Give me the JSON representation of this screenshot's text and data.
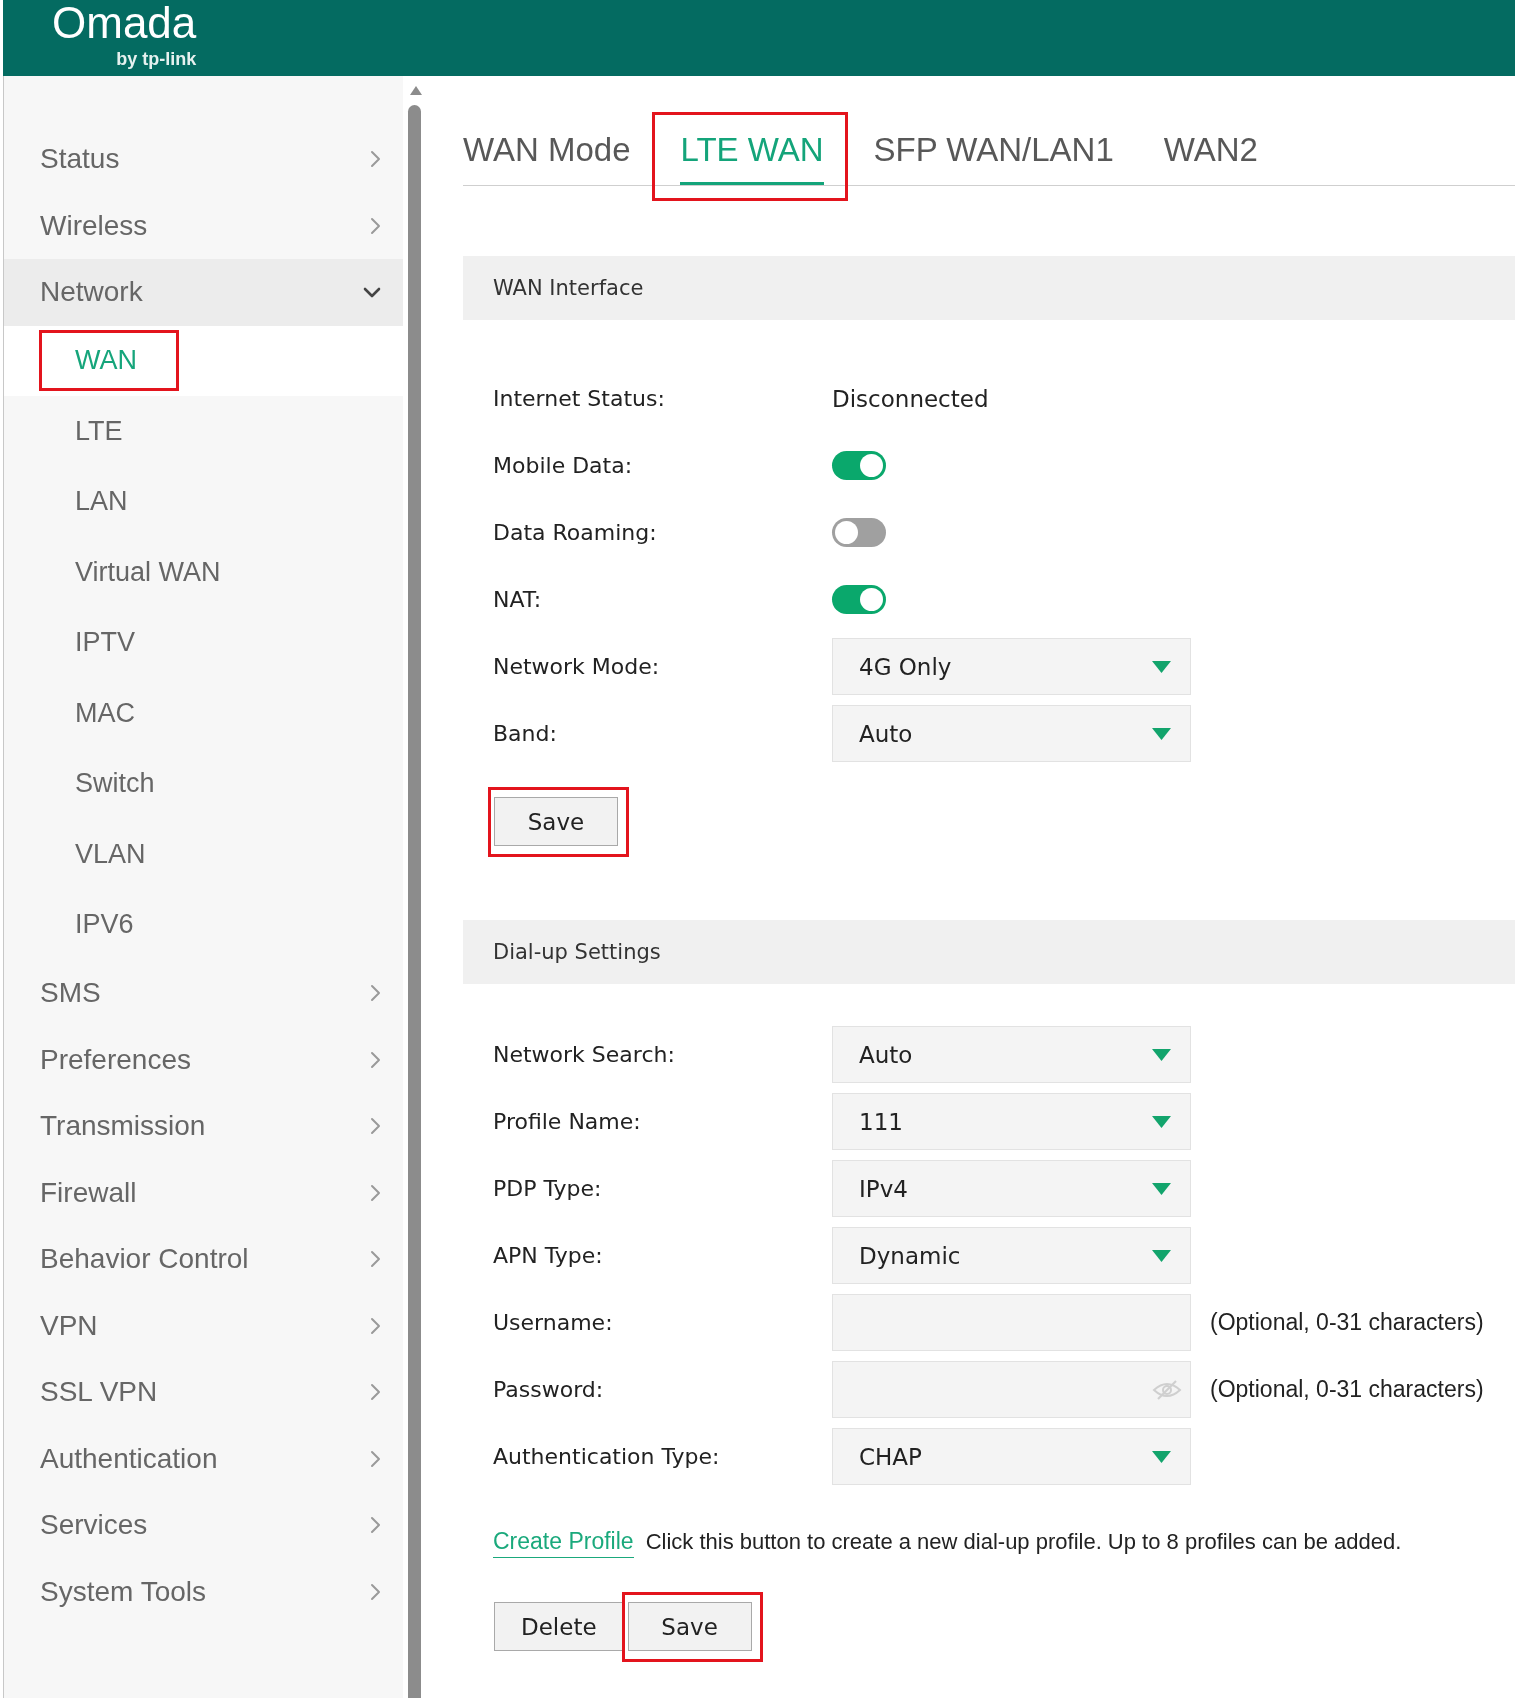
{
  "header": {
    "logo": "Omada",
    "logo_tagline": "by tp-link"
  },
  "sidebar": {
    "items": [
      {
        "label": "Status",
        "expanded": false
      },
      {
        "label": "Wireless",
        "expanded": false
      },
      {
        "label": "Network",
        "expanded": true,
        "children": [
          {
            "label": "WAN",
            "selected": true,
            "highlighted": true
          },
          {
            "label": "LTE",
            "selected": false,
            "highlighted": false
          },
          {
            "label": "LAN",
            "selected": false,
            "highlighted": false
          },
          {
            "label": "Virtual WAN",
            "selected": false,
            "highlighted": false
          },
          {
            "label": "IPTV",
            "selected": false,
            "highlighted": false
          },
          {
            "label": "MAC",
            "selected": false,
            "highlighted": false
          },
          {
            "label": "Switch",
            "selected": false,
            "highlighted": false
          },
          {
            "label": "VLAN",
            "selected": false,
            "highlighted": false
          },
          {
            "label": "IPV6",
            "selected": false,
            "highlighted": false
          }
        ]
      },
      {
        "label": "SMS",
        "expanded": false
      },
      {
        "label": "Preferences",
        "expanded": false
      },
      {
        "label": "Transmission",
        "expanded": false
      },
      {
        "label": "Firewall",
        "expanded": false
      },
      {
        "label": "Behavior Control",
        "expanded": false
      },
      {
        "label": "VPN",
        "expanded": false
      },
      {
        "label": "SSL VPN",
        "expanded": false
      },
      {
        "label": "Authentication",
        "expanded": false
      },
      {
        "label": "Services",
        "expanded": false
      },
      {
        "label": "System Tools",
        "expanded": false
      }
    ]
  },
  "tabs": [
    {
      "label": "WAN Mode",
      "selected": false,
      "highlighted": false
    },
    {
      "label": "LTE WAN",
      "selected": true,
      "highlighted": true
    },
    {
      "label": "SFP WAN/LAN1",
      "selected": false,
      "highlighted": false
    },
    {
      "label": "WAN2",
      "selected": false,
      "highlighted": false
    }
  ],
  "sections": [
    {
      "title": "WAN Interface",
      "fields": [
        {
          "kind": "text",
          "label": "Internet Status:",
          "value": "Disconnected"
        },
        {
          "kind": "toggle",
          "label": "Mobile Data:",
          "on": true
        },
        {
          "kind": "toggle",
          "label": "Data Roaming:",
          "on": false
        },
        {
          "kind": "toggle",
          "label": "NAT:",
          "on": true
        },
        {
          "kind": "select",
          "label": "Network Mode:",
          "value": "4G Only"
        },
        {
          "kind": "select",
          "label": "Band:",
          "value": "Auto"
        }
      ],
      "buttons": [
        {
          "label": "Save",
          "highlighted": true
        }
      ]
    },
    {
      "title": "Dial-up Settings",
      "fields": [
        {
          "kind": "select",
          "label": "Network Search:",
          "value": "Auto"
        },
        {
          "kind": "select",
          "label": "Profile Name:",
          "value": "111"
        },
        {
          "kind": "select",
          "label": "PDP Type:",
          "value": "IPv4"
        },
        {
          "kind": "select",
          "label": "APN Type:",
          "value": "Dynamic"
        },
        {
          "kind": "input",
          "label": "Username:",
          "note": "(Optional, 0-31 characters)"
        },
        {
          "kind": "password",
          "label": "Password:",
          "note": "(Optional, 0-31 characters)"
        },
        {
          "kind": "select",
          "label": "Authentication Type:",
          "value": "CHAP"
        }
      ],
      "link": {
        "label": "Create Profile",
        "description": "Click this button to create a new dial-up profile. Up to 8 profiles can be added."
      },
      "buttons": [
        {
          "label": "Delete",
          "highlighted": false
        },
        {
          "label": "Save",
          "highlighted": true
        }
      ]
    }
  ]
}
